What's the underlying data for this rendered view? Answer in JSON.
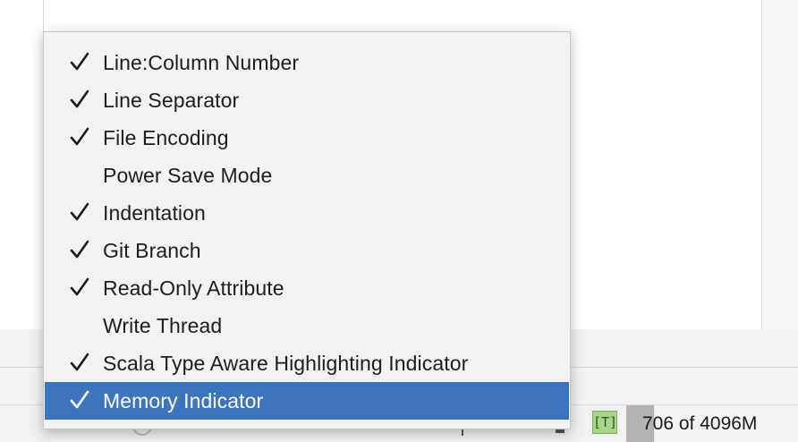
{
  "menu": {
    "items": [
      {
        "label": "Line:Column Number",
        "checked": true,
        "selected": false
      },
      {
        "label": "Line Separator",
        "checked": true,
        "selected": false
      },
      {
        "label": "File Encoding",
        "checked": true,
        "selected": false
      },
      {
        "label": "Power Save Mode",
        "checked": false,
        "selected": false
      },
      {
        "label": "Indentation",
        "checked": true,
        "selected": false
      },
      {
        "label": "Git Branch",
        "checked": true,
        "selected": false
      },
      {
        "label": "Read-Only Attribute",
        "checked": true,
        "selected": false
      },
      {
        "label": "Write Thread",
        "checked": false,
        "selected": false
      },
      {
        "label": "Scala Type Aware Highlighting Indicator",
        "checked": true,
        "selected": false
      },
      {
        "label": "Memory Indicator",
        "checked": true,
        "selected": true
      }
    ]
  },
  "statusbar": {
    "scala_badge": "[T]",
    "memory": {
      "text": "706 of 4096M",
      "used_mb": 706,
      "total_mb": 4096
    }
  },
  "colors": {
    "selection": "#3c74bd",
    "scala_badge_bg": "#a8d58a",
    "memory_fill": "#b3b3b3"
  },
  "icons": {
    "check": "checkmark-icon",
    "branch": "git-branch-icon",
    "lock": "lock-icon",
    "spinner": "progress-spinner-icon"
  }
}
